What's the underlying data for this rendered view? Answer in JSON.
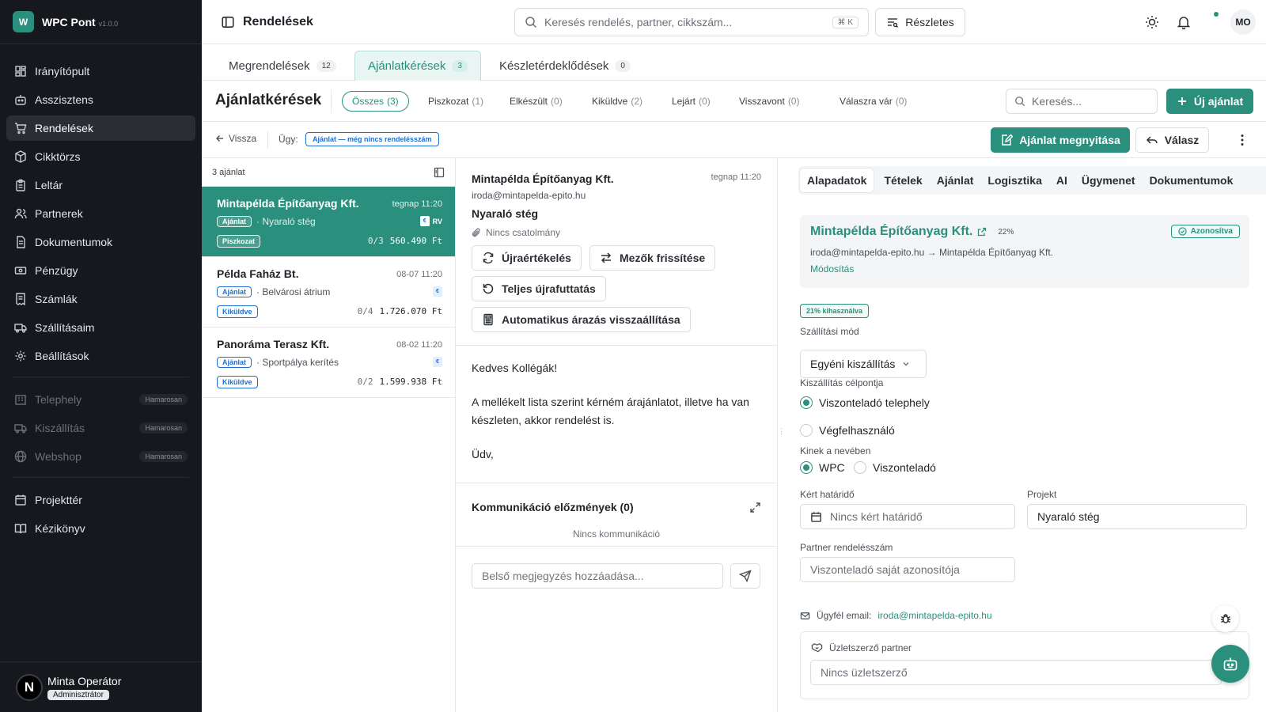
{
  "app": {
    "name": "WPC Pont",
    "version": "v1.0.0",
    "logo_letter": "W",
    "accent": "#2a8f7d"
  },
  "sidebar": {
    "items": [
      {
        "label": "Irányítópult",
        "icon": "dashboard-icon"
      },
      {
        "label": "Asszisztens",
        "icon": "bot-icon"
      },
      {
        "label": "Rendelések",
        "icon": "cart-icon",
        "active": true
      },
      {
        "label": "Cikktörzs",
        "icon": "package-icon"
      },
      {
        "label": "Leltár",
        "icon": "clipboard-icon"
      },
      {
        "label": "Partnerek",
        "icon": "users-icon"
      },
      {
        "label": "Dokumentumok",
        "icon": "document-icon"
      },
      {
        "label": "Pénzügy",
        "icon": "banknote-icon"
      },
      {
        "label": "Számlák",
        "icon": "receipt-icon"
      },
      {
        "label": "Szállításaim",
        "icon": "truck-icon"
      },
      {
        "label": "Beállítások",
        "icon": "gear-icon"
      }
    ],
    "upcoming": [
      {
        "label": "Telephely",
        "badge": "Hamarosan",
        "icon": "building-icon"
      },
      {
        "label": "Kiszállítás",
        "badge": "Hamarosan",
        "icon": "truck-icon"
      },
      {
        "label": "Webshop",
        "badge": "Hamarosan",
        "icon": "globe-icon"
      }
    ],
    "bottom": [
      {
        "label": "Projekttér",
        "icon": "calendar-icon"
      },
      {
        "label": "Kézikönyv",
        "icon": "book-icon"
      }
    ],
    "user": {
      "initial": "N",
      "name": "Minta Operátor",
      "role": "Adminisztrátor"
    }
  },
  "topbar": {
    "title": "Rendelések",
    "search_placeholder": "Keresés rendelés, partner, cikkszám...",
    "shortcut": "⌘ K",
    "advanced_label": "Részletes",
    "avatar_initials": "MO"
  },
  "tabs": [
    {
      "label": "Megrendelések",
      "count": "12"
    },
    {
      "label": "Ajánlatkérések",
      "count": "3",
      "active": true
    },
    {
      "label": "Készletérdeklődések",
      "count": "0"
    }
  ],
  "filterbar": {
    "title": "Ajánlatkérések",
    "chips": [
      {
        "label": "Összes",
        "count": "(3)",
        "active": true
      },
      {
        "label": "Piszkozat",
        "count": "(1)"
      },
      {
        "label": "Elkészült",
        "count": "(0)"
      },
      {
        "label": "Kiküldve",
        "count": "(2)"
      },
      {
        "label": "Lejárt",
        "count": "(0)"
      },
      {
        "label": "Visszavont",
        "count": "(0)"
      },
      {
        "label": "Válaszra vár",
        "count": "(0)"
      }
    ],
    "search_placeholder": "Keresés...",
    "new_label": "Új ajánlat"
  },
  "actionbar": {
    "back_label": "Vissza",
    "case_label": "Ügy:",
    "case_badge": "Ajánlat — még nincs rendelésszám",
    "open_label": "Ajánlat megnyitása",
    "reply_label": "Válasz"
  },
  "list": {
    "count_label": "3 ajánlat",
    "items": [
      {
        "name": "Mintapélda Építőanyag Kft.",
        "date": "tegnap 11:20",
        "type": "Ajánlat",
        "project": "· Nyaraló stég",
        "flag": "€",
        "flag_text": "RV",
        "status": "Piszkozat",
        "fraction": "0/3",
        "amount": "560.490 Ft",
        "selected": true
      },
      {
        "name": "Példa Faház Bt.",
        "date": "08-07 11:20",
        "type": "Ajánlat",
        "project": "· Belvárosi átrium",
        "flag": "€",
        "flag_text": "",
        "status": "Kiküldve",
        "fraction": "0/4",
        "amount": "1.726.070 Ft"
      },
      {
        "name": "Panoráma Terasz Kft.",
        "date": "08-02 11:20",
        "type": "Ajánlat",
        "project": "· Sportpálya kerítés",
        "flag": "€",
        "flag_text": "",
        "status": "Kiküldve",
        "fraction": "0/2",
        "amount": "1.599.938 Ft"
      }
    ]
  },
  "message": {
    "from": "Mintapélda Építőanyag Kft.",
    "date": "tegnap 11:20",
    "email": "iroda@mintapelda-epito.hu",
    "subject": "Nyaraló stég",
    "attachment": "Nincs csatolmány",
    "buttons": {
      "reeval": "Újraértékelés",
      "refresh": "Mezők frissítése",
      "rerun": "Teljes újrafuttatás",
      "reset_pricing": "Automatikus árazás visszaállítása"
    },
    "body": [
      "Kedves Kollégák!",
      "A mellékelt lista szerint kérném árajánlatot, illetve ha van készleten, akkor rendelést is.",
      "Üdv,"
    ],
    "comm_title": "Kommunikáció előzmények (0)",
    "comm_empty": "Nincs kommunikáció",
    "note_placeholder": "Belső megjegyzés hozzáadása..."
  },
  "detail": {
    "tabs": [
      "Alapadatok",
      "Tételek",
      "Ajánlat",
      "Logisztika",
      "AI",
      "Ügymenet",
      "Dokumentumok"
    ],
    "partner": {
      "name": "Mintapélda Építőanyag Kft.",
      "pct": "22%",
      "verified": "Azonosítva",
      "mapping": "iroda@mintapelda-epito.hu → Mintapélda Építőanyag Kft.",
      "modify": "Módosítás"
    },
    "usage_badge": "21% kihasználva",
    "shipping_label": "Szállítási mód",
    "shipping_value": "Egyéni kiszállítás",
    "target_label": "Kiszállítás célpontja",
    "target_options": [
      "Viszonteladó telephely",
      "Végfelhasználó"
    ],
    "behalf_label": "Kinek a nevében",
    "behalf_options": [
      "WPC",
      "Viszonteladó"
    ],
    "deadline_label": "Kért határidő",
    "deadline_placeholder": "Nincs kért határidő",
    "project_label": "Projekt",
    "project_value": "Nyaraló stég",
    "partner_order_label": "Partner rendelésszám",
    "partner_order_placeholder": "Viszonteladó saját azonosítója",
    "client_email_label": "Ügyfél email:",
    "client_email": "iroda@mintapelda-epito.hu",
    "broker_label": "Üzletszerző partner",
    "broker_placeholder": "Nincs üzletszerző"
  }
}
